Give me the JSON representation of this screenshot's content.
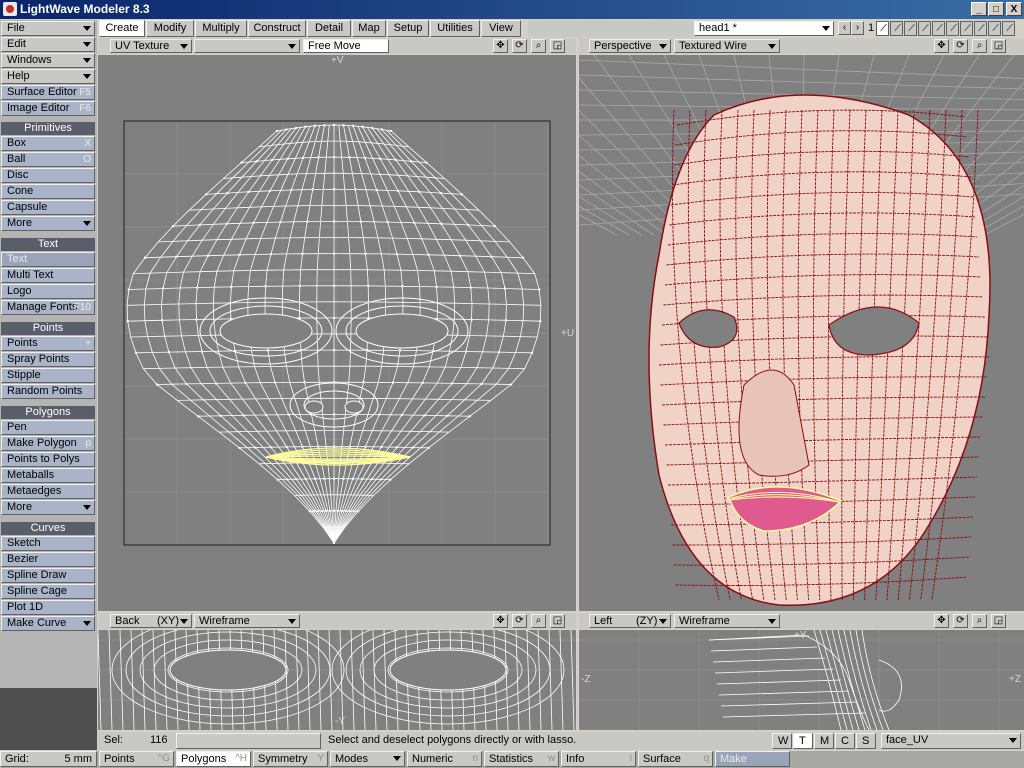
{
  "window": {
    "title": "LightWave Modeler 8.3",
    "minimize": "_",
    "maximize": "□",
    "close": "X"
  },
  "menu_buttons": [
    {
      "label": "File",
      "key": "",
      "arrow": true
    },
    {
      "label": "Edit",
      "key": "",
      "arrow": true
    },
    {
      "label": "Windows",
      "key": "",
      "arrow": true
    },
    {
      "label": "Help",
      "key": "",
      "arrow": true
    },
    {
      "label": "Surface Editor",
      "key": "F5",
      "arrow": false
    },
    {
      "label": "Image Editor",
      "key": "F6",
      "arrow": false
    }
  ],
  "groups": [
    {
      "title": "Primitives",
      "items": [
        {
          "label": "Box",
          "key": "X"
        },
        {
          "label": "Ball",
          "key": "O"
        },
        {
          "label": "Disc",
          "key": ""
        },
        {
          "label": "Cone",
          "key": ""
        },
        {
          "label": "Capsule",
          "key": ""
        },
        {
          "label": "More",
          "key": "",
          "arrow": true
        }
      ]
    },
    {
      "title": "Text",
      "items": [
        {
          "label": "Text",
          "key": "",
          "dim": true
        },
        {
          "label": "Multi Text",
          "key": ""
        },
        {
          "label": "Logo",
          "key": ""
        },
        {
          "label": "Manage Fonts",
          "key": "F10"
        }
      ]
    },
    {
      "title": "Points",
      "items": [
        {
          "label": "Points",
          "key": "+"
        },
        {
          "label": "Spray Points",
          "key": ""
        },
        {
          "label": "Stipple",
          "key": ""
        },
        {
          "label": "Random Points",
          "key": ""
        }
      ]
    },
    {
      "title": "Polygons",
      "items": [
        {
          "label": "Pen",
          "key": ""
        },
        {
          "label": "Make Polygon",
          "key": "p"
        },
        {
          "label": "Points to Polys",
          "key": ""
        },
        {
          "label": "Metaballs",
          "key": ""
        },
        {
          "label": "Metaedges",
          "key": ""
        },
        {
          "label": "More",
          "key": "",
          "arrow": true
        }
      ]
    },
    {
      "title": "Curves",
      "items": [
        {
          "label": "Sketch",
          "key": ""
        },
        {
          "label": "Bezier",
          "key": ""
        },
        {
          "label": "Spline Draw",
          "key": ""
        },
        {
          "label": "Spline Cage",
          "key": ""
        },
        {
          "label": "Plot 1D",
          "key": ""
        },
        {
          "label": "Make Curve",
          "key": "",
          "arrow": true
        }
      ]
    }
  ],
  "tabs": [
    "Create",
    "Modify",
    "Multiply",
    "Construct",
    "Detail",
    "Map",
    "Setup",
    "Utilities",
    "View"
  ],
  "active_tab": "Create",
  "object_select": {
    "value": "head1 *",
    "layer_num": "1"
  },
  "viewports": {
    "uv": {
      "view": "UV Texture",
      "tool": "Free Move",
      "axis_v": "+V",
      "axis_u": "+U"
    },
    "persp": {
      "view": "Perspective",
      "mode": "Textured Wire"
    },
    "back": {
      "view": "Back",
      "axes": "(XY)",
      "mode": "Wireframe",
      "axis_y": "-Y"
    },
    "left": {
      "view": "Left",
      "axes": "(ZY)",
      "mode": "Wireframe",
      "axis_y": "+Y",
      "axis_z": "-Z",
      "axis_z2": "+Z"
    }
  },
  "status": {
    "sel_label": "Sel:",
    "sel_count": "116",
    "message": "Select and deselect polygons directly or with lasso.",
    "wtmcs": [
      "W",
      "T",
      "M",
      "C",
      "S"
    ],
    "active_wtmcs": "T",
    "vmap": "face_UV",
    "grid_label": "Grid:",
    "grid_value": "5 mm"
  },
  "modes": [
    {
      "label": "Points",
      "key": "^G"
    },
    {
      "label": "Polygons",
      "key": "^H",
      "active": true
    },
    {
      "label": "Symmetry",
      "key": "Y"
    },
    {
      "label": "Modes",
      "key": "",
      "arrow": true
    },
    {
      "label": "Numeric",
      "key": "n"
    },
    {
      "label": "Statistics",
      "key": "w"
    },
    {
      "label": "Info",
      "key": "i"
    },
    {
      "label": "Surface",
      "key": "q"
    },
    {
      "label": "Make",
      "key": "",
      "dim": true
    }
  ],
  "colors": {
    "viewport_bg": "#808080",
    "wire_white": "#ffffff",
    "wire_red": "#8a0d14",
    "skin": "#f0d2c6",
    "lips": "#e05a90",
    "selected": "#ffffa0"
  }
}
